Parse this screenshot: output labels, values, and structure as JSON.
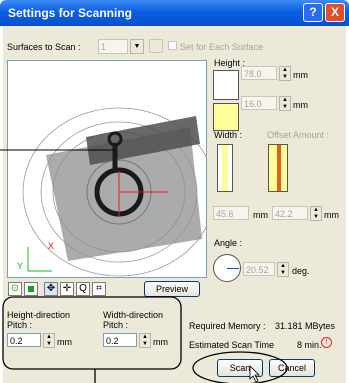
{
  "window": {
    "title": "Settings for Scanning",
    "help_glyph": "?",
    "close_glyph": "X"
  },
  "surfaces": {
    "label": "Surfaces to Scan :",
    "value": "1",
    "set_each_label": "Set for Each Surface"
  },
  "height": {
    "label": "Height :",
    "value1": "78.0",
    "value2": "16.0",
    "unit": "mm"
  },
  "width": {
    "label": "Width :",
    "offset_label": "Offset Amount :",
    "value": "45.6",
    "offset_value": "42.2",
    "unit": "mm"
  },
  "angle": {
    "label": "Angle :",
    "value": "20.52",
    "unit": "deg."
  },
  "preview": {
    "button_label": "Preview"
  },
  "pitch": {
    "height_label_1": "Height-direction",
    "height_label_2": "Pitch :",
    "width_label_1": "Width-direction",
    "width_label_2": "Pitch :",
    "height_value": "0.2",
    "width_value": "0.2",
    "unit": "mm"
  },
  "memory": {
    "label": "Required Memory :",
    "value": "31.181 MBytes"
  },
  "scan_time": {
    "label": "Estimated Scan Time",
    "value": "8 min."
  },
  "buttons": {
    "scan": "Scan",
    "cancel": "Cancel"
  },
  "axes": {
    "x": "X",
    "y": "Y"
  },
  "colors": {
    "title_blue": "#0a5fe0",
    "callout": "#000000"
  }
}
